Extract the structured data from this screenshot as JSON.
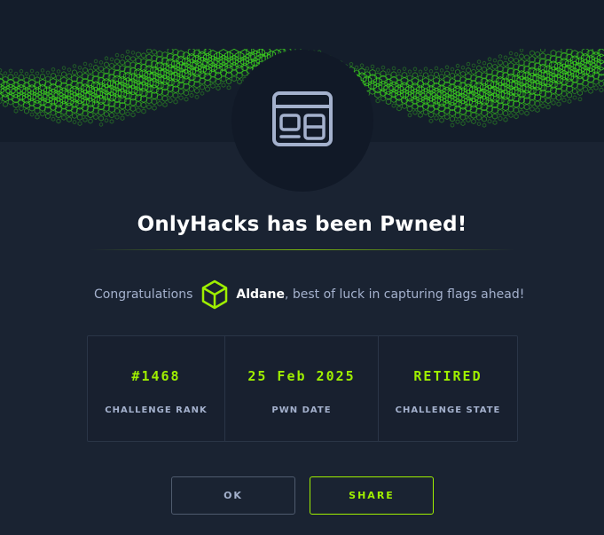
{
  "colors": {
    "background": "#1a2332",
    "accent": "#9fef00",
    "muted_text": "#a4b1cd",
    "icon_circle": "#111927"
  },
  "icons": {
    "banner": "green-hex-wave-banner",
    "challenge": "web-window-icon",
    "avatar": "green-cube-icon"
  },
  "modal": {
    "title": "OnlyHacks has been Pwned!",
    "congrats_prefix": "Congratulations",
    "username": "Aldane",
    "congrats_suffix": ", best of luck in capturing flags ahead!"
  },
  "stats": [
    {
      "value": "#1468",
      "label": "CHALLENGE RANK"
    },
    {
      "value": "25 Feb 2025",
      "label": "PWN DATE"
    },
    {
      "value": "RETIRED",
      "label": "CHALLENGE STATE"
    }
  ],
  "buttons": {
    "ok": "OK",
    "share": "SHARE"
  }
}
